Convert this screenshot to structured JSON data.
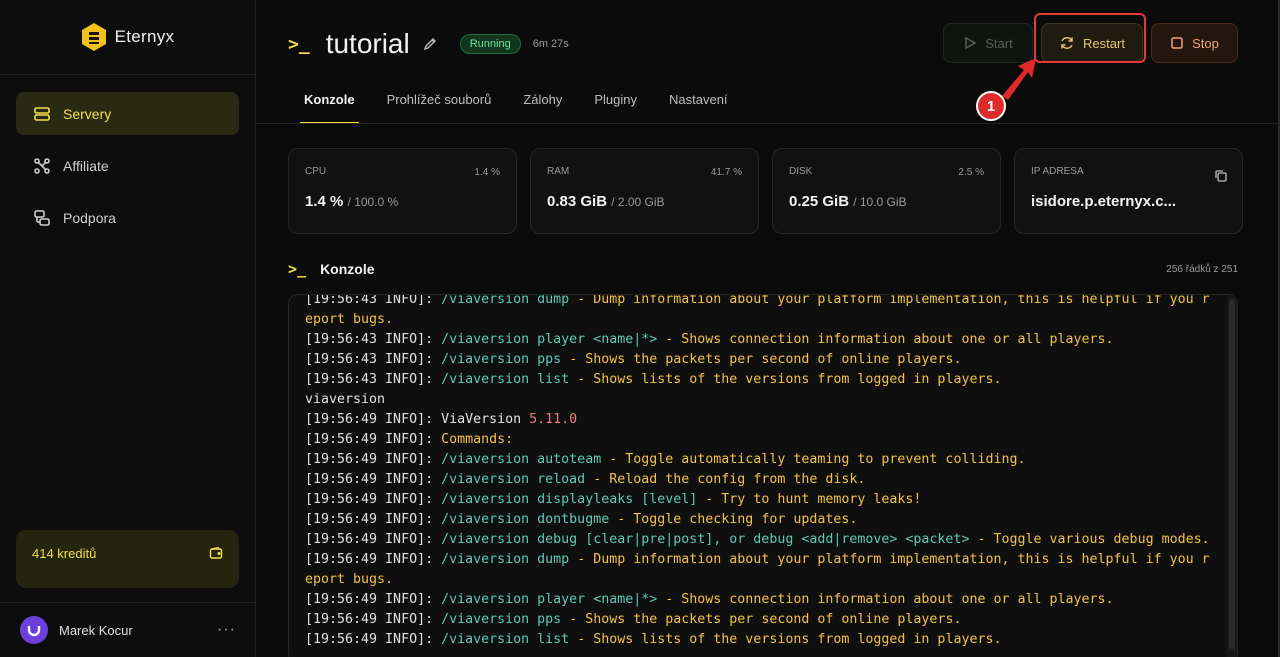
{
  "brand": {
    "name": "Eternyx"
  },
  "sidebar": {
    "items": [
      {
        "label": "Servery",
        "icon": "server-icon"
      },
      {
        "label": "Affiliate",
        "icon": "network-icon"
      },
      {
        "label": "Podpora",
        "icon": "support-icon"
      }
    ],
    "credits_label": "414 kreditů",
    "user_name": "Marek Kocur",
    "menu_dots": "···"
  },
  "header": {
    "prompt": ">_",
    "title": "tutorial",
    "status": "Running",
    "uptime": "6m 27s"
  },
  "actions": {
    "start": "Start",
    "restart": "Restart",
    "stop": "Stop",
    "step_marker": "1"
  },
  "tabs": [
    "Konzole",
    "Prohlížeč souborů",
    "Zálohy",
    "Pluginy",
    "Nastavení"
  ],
  "stats": {
    "cpu": {
      "label": "CPU",
      "pct": "1.4 %",
      "value": "1.4 %",
      "sub": "/ 100.0 %"
    },
    "ram": {
      "label": "RAM",
      "pct": "41.7 %",
      "value": "0.83 GiB",
      "sub": "/ 2.00 GiB"
    },
    "disk": {
      "label": "DISK",
      "pct": "2.5 %",
      "value": "0.25 GiB",
      "sub": "/ 10.0 GiB"
    },
    "ip": {
      "label": "IP ADRESA",
      "value": "isidore.p.eternyx.c..."
    }
  },
  "console": {
    "prompt": ">_",
    "title": "Konzole",
    "line_count": "256 řádků z 251",
    "lines": [
      [
        [
          "ts",
          "[19:56:43 INFO]: "
        ],
        [
          "cmd",
          "/viaversion dump"
        ],
        [
          "desc",
          " - Dump information about your platform implementation, this is helpful if you report bugs."
        ]
      ],
      [
        [
          "ts",
          "[19:56:43 INFO]: "
        ],
        [
          "cmd",
          "/viaversion player <name|*>"
        ],
        [
          "desc",
          " - Shows connection information about one or all players."
        ]
      ],
      [
        [
          "ts",
          "[19:56:43 INFO]: "
        ],
        [
          "cmd",
          "/viaversion pps"
        ],
        [
          "desc",
          " - Shows the packets per second of online players."
        ]
      ],
      [
        [
          "ts",
          "[19:56:43 INFO]: "
        ],
        [
          "cmd",
          "/viaversion list"
        ],
        [
          "desc",
          " - Shows lists of the versions from logged in players."
        ]
      ],
      [
        [
          "ts",
          "viaversion"
        ]
      ],
      [
        [
          "ts",
          "[19:56:49 INFO]: "
        ],
        [
          "ts",
          "ViaVersion "
        ],
        [
          "ver",
          "5.11.0"
        ]
      ],
      [
        [
          "ts",
          "[19:56:49 INFO]: "
        ],
        [
          "desc",
          "Commands:"
        ]
      ],
      [
        [
          "ts",
          "[19:56:49 INFO]: "
        ],
        [
          "cmd",
          "/viaversion autoteam"
        ],
        [
          "desc",
          " - Toggle automatically teaming to prevent colliding."
        ]
      ],
      [
        [
          "ts",
          "[19:56:49 INFO]: "
        ],
        [
          "cmd",
          "/viaversion reload"
        ],
        [
          "desc",
          " - Reload the config from the disk."
        ]
      ],
      [
        [
          "ts",
          "[19:56:49 INFO]: "
        ],
        [
          "cmd",
          "/viaversion displayleaks [level]"
        ],
        [
          "desc",
          " - Try to hunt memory leaks!"
        ]
      ],
      [
        [
          "ts",
          "[19:56:49 INFO]: "
        ],
        [
          "cmd",
          "/viaversion dontbugme"
        ],
        [
          "desc",
          " - Toggle checking for updates."
        ]
      ],
      [
        [
          "ts",
          "[19:56:49 INFO]: "
        ],
        [
          "cmd",
          "/viaversion debug [clear|pre|post], or debug <add|remove> <packet>"
        ],
        [
          "desc",
          " - Toggle various debug modes."
        ]
      ],
      [
        [
          "ts",
          "[19:56:49 INFO]: "
        ],
        [
          "cmd",
          "/viaversion dump"
        ],
        [
          "desc",
          " - Dump information about your platform implementation, this is helpful if you report bugs."
        ]
      ],
      [
        [
          "ts",
          "[19:56:49 INFO]: "
        ],
        [
          "cmd",
          "/viaversion player <name|*>"
        ],
        [
          "desc",
          " - Shows connection information about one or all players."
        ]
      ],
      [
        [
          "ts",
          "[19:56:49 INFO]: "
        ],
        [
          "cmd",
          "/viaversion pps"
        ],
        [
          "desc",
          " - Shows the packets per second of online players."
        ]
      ],
      [
        [
          "ts",
          "[19:56:49 INFO]: "
        ],
        [
          "cmd",
          "/viaversion list"
        ],
        [
          "desc",
          " - Shows lists of the versions from logged in players."
        ]
      ]
    ]
  },
  "colors": {
    "accent": "#f4e046",
    "highlight": "#e53939",
    "running": "#6ee79a"
  }
}
